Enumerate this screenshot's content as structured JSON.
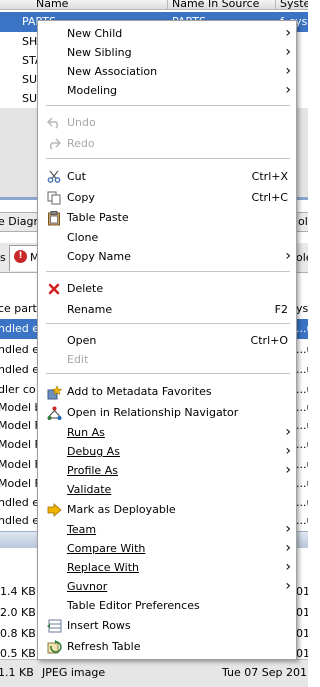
{
  "table": {
    "headers": [
      "Name",
      "Name In Source",
      "Syste"
    ],
    "rows": [
      {
        "name": "PARTS",
        "source": "PARTS",
        "sys": "f_syste"
      },
      {
        "name": "SH",
        "source": "",
        "sys": ""
      },
      {
        "name": "STA",
        "source": "",
        "sys": ""
      },
      {
        "name": "SU",
        "source": "",
        "sys": ""
      },
      {
        "name": "SU",
        "source": "",
        "sys": ""
      }
    ]
  },
  "panel": {
    "tab_left": "e Diagr",
    "tab_right": "ol",
    "tab2_left": "s",
    "tab2_mid": "M",
    "tab2_right": "ole",
    "col_left": "ce parti",
    "col_right": "ys"
  },
  "results": {
    "rows": [
      {
        "left": "ndled e",
        "right": "...u"
      },
      {
        "left": "ndled e",
        "right": "...u"
      },
      {
        "left": "ndled e",
        "right": "...u"
      },
      {
        "left": "dler co",
        "right": "...u"
      },
      {
        "left": "Model b",
        "right": "...u"
      },
      {
        "left": "Model F",
        "right": "...u"
      },
      {
        "left": "Model F",
        "right": "...u"
      },
      {
        "left": "Model F",
        "right": "...u"
      },
      {
        "left": "Model F",
        "right": "...u"
      },
      {
        "left": "ndled e",
        "right": "...u"
      },
      {
        "left": "ndled e",
        "right": "...u"
      }
    ]
  },
  "files": {
    "rows": [
      {
        "size": "1.4 KB",
        "right": "01"
      },
      {
        "size": "2.0 KB",
        "right": "01"
      },
      {
        "size": "0.8 KB",
        "right": "01"
      },
      {
        "size": "0.5 KB",
        "right": "01"
      }
    ],
    "bottom": {
      "size": "1.1 KB",
      "type": "JPEG image",
      "date": "Tue 07 Sep 201"
    }
  },
  "menu": {
    "new_child": "New Child",
    "new_sibling": "New Sibling",
    "new_association": "New Association",
    "modeling": "Modeling",
    "undo": "Undo",
    "redo": "Redo",
    "cut": "Cut",
    "cut_sc": "Ctrl+X",
    "copy": "Copy",
    "copy_sc": "Ctrl+C",
    "table_paste": "Table Paste",
    "clone": "Clone",
    "copy_name": "Copy Name",
    "delete": "Delete",
    "rename": "Rename",
    "rename_sc": "F2",
    "open": "Open",
    "open_sc": "Ctrl+O",
    "edit": "Edit",
    "add_favorites": "Add to Metadata Favorites",
    "open_relationship": "Open in Relationship Navigator",
    "run_as": "Run As",
    "debug_as": "Debug As",
    "profile_as": "Profile As",
    "validate": "Validate",
    "mark_deployable": "Mark as Deployable",
    "team": "Team",
    "compare_with": "Compare With",
    "replace_with": "Replace With",
    "guvnor": "Guvnor",
    "table_editor_prefs": "Table Editor Preferences",
    "insert_rows": "Insert Rows",
    "refresh_table": "Refresh Table",
    "submenu_arrow": "›"
  },
  "icons": {
    "undo": "undo-arrow-icon",
    "redo": "redo-arrow-icon",
    "cut": "scissors-icon",
    "copy": "copy-pages-icon",
    "table_paste": "clipboard-icon",
    "delete": "red-x-icon",
    "add_favorites": "favorites-star-icon",
    "open_relationship": "relationship-navigator-icon",
    "mark_deployable": "deploy-arrow-icon",
    "insert_rows": "insert-rows-icon",
    "refresh_table": "refresh-table-icon"
  },
  "colors": {
    "selection": "#3b74c4",
    "delete_red": "#d32020",
    "disabled_text": "#a8a8a8"
  }
}
